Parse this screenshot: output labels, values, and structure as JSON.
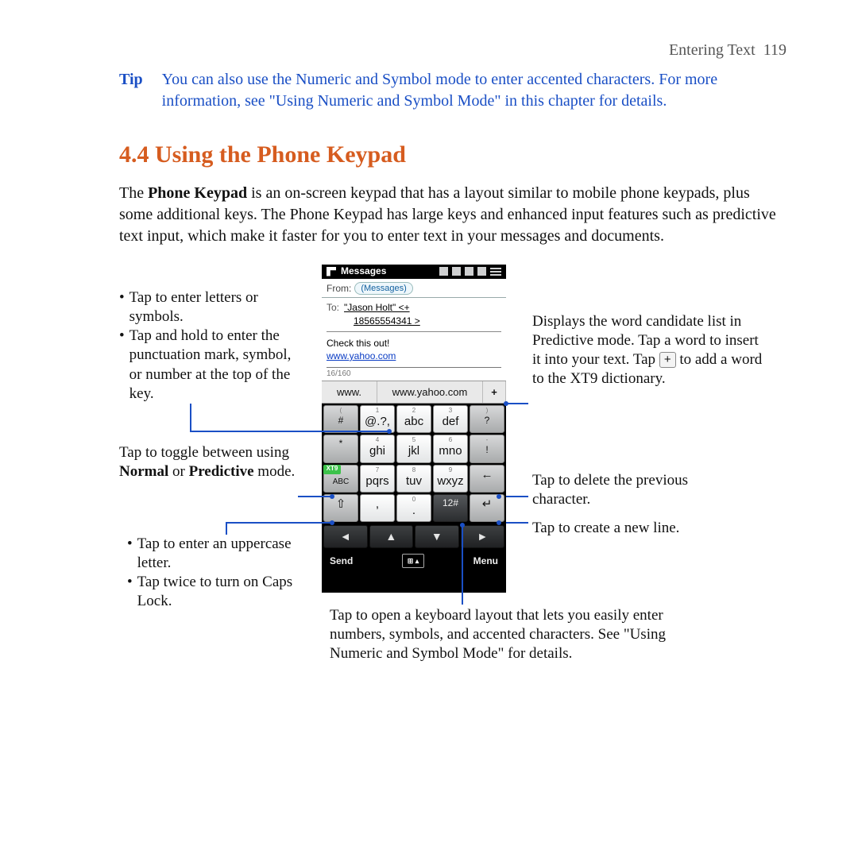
{
  "header": {
    "section": "Entering Text",
    "page": "119"
  },
  "tip": {
    "label": "Tip",
    "text": "You can also use the Numeric and Symbol mode to enter accented characters. For more information, see \"Using Numeric and Symbol Mode\" in this chapter for details."
  },
  "heading": "4.4  Using the Phone Keypad",
  "intro_pre": "The ",
  "intro_bold": "Phone Keypad",
  "intro_post": " is an on-screen keypad that has a layout similar to mobile phone keypads, plus some additional keys. The Phone Keypad has large keys and enhanced input features such as predictive text input, which make it faster for you to enter text in your messages and documents.",
  "left": {
    "b1": "Tap to enter letters or symbols.",
    "b2": "Tap and hold to enter the punctuation mark, symbol, or number at the top of the key.",
    "toggle_a": "Tap to toggle between using ",
    "toggle_b": "Normal",
    "toggle_c": " or ",
    "toggle_d": "Predictive",
    "toggle_e": " mode.",
    "b3": "Tap to enter an uppercase letter.",
    "b4": "Tap twice to turn on Caps Lock."
  },
  "right": {
    "cand_a": "Displays the word candidate list in Predictive mode. Tap a word to insert it into your text. Tap ",
    "cand_b": " to add a word to the XT9 dictionary.",
    "cand_plus": "+",
    "del": "Tap to delete the previous character.",
    "newline": "Tap to create a new line."
  },
  "bottom": {
    "symmode": "Tap to open a keyboard layout that lets you easily enter numbers, symbols, and accented characters. See \"Using Numeric and Symbol Mode\" for details."
  },
  "phone": {
    "title": "Messages",
    "from_label": "From:",
    "from_tag": "(Messages)",
    "to_label": "To:",
    "to_value": "\"Jason Holt\" <+",
    "to_value2": "18565554341 >",
    "body_line1": "Check this out!",
    "body_link": "www.yahoo.com",
    "count": "16/160",
    "cand": [
      "www.",
      "www.yahoo.com",
      "+"
    ],
    "row1": {
      "k1_top": "(",
      "k1": "#",
      "k2_top": "1",
      "k2": "@.?,",
      "k3_top": "2",
      "k3": "abc",
      "k4_top": "3",
      "k4": "def",
      "k5_top": ")",
      "k5": "?"
    },
    "row2": {
      "k1_top": "",
      "k1": "*",
      "k2_top": "4",
      "k2": "ghi",
      "k3_top": "5",
      "k3": "jkl",
      "k4_top": "6",
      "k4": "mno",
      "k5_top": "-",
      "k5": "!"
    },
    "row3": {
      "badge": "XT9",
      "k1": "ABC",
      "k2_top": "7",
      "k2": "pqrs",
      "k3_top": "8",
      "k3": "tuv",
      "k4_top": "9",
      "k4": "wxyz",
      "k5": "←"
    },
    "row4": {
      "k1": "⇧",
      "k2": ",",
      "k3_top": "0",
      "k3": ".",
      "k4": "12#",
      "k5": "↵"
    },
    "nav": {
      "l": "◄",
      "u": "▲",
      "d": "▼",
      "r": "►"
    },
    "soft_left": "Send",
    "soft_right": "Menu",
    "soft_mid": "⊞ ▴"
  }
}
